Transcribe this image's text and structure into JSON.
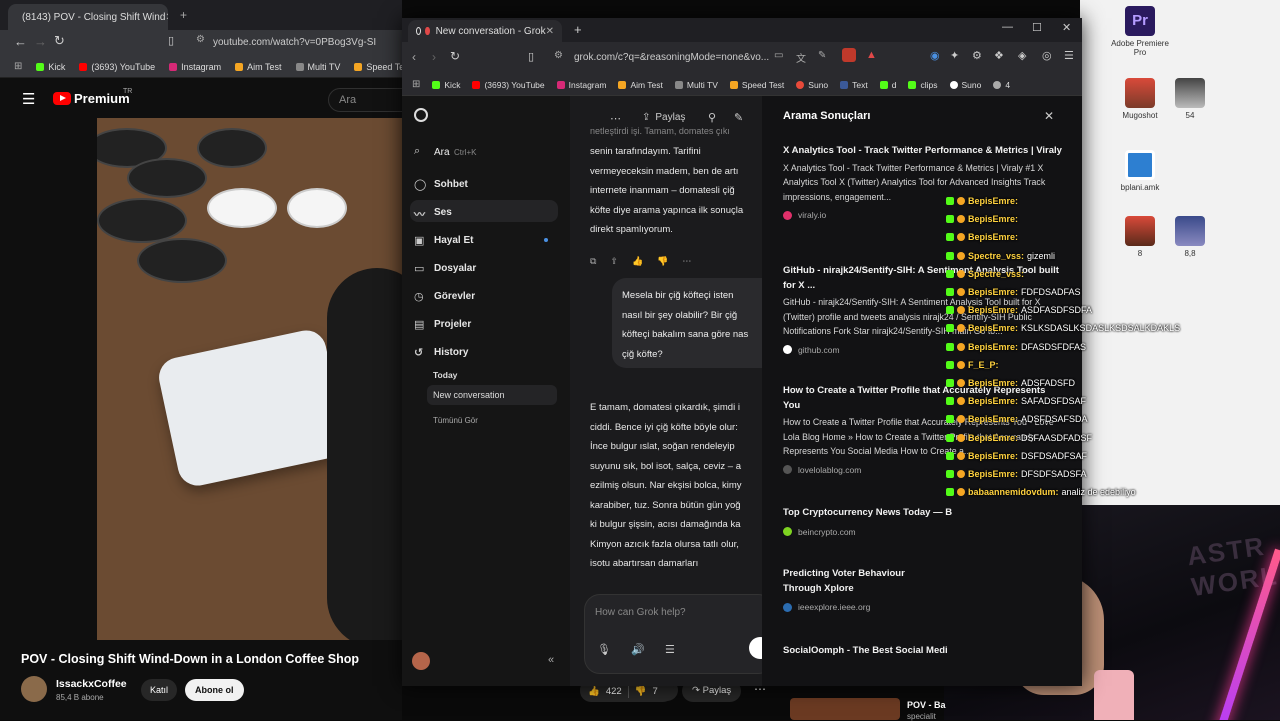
{
  "youtube_window": {
    "tab_title": "(8143) POV - Closing Shift Wind",
    "url": "youtube.com/watch?v=0PBog3Vg-SI",
    "bookmarks": [
      "Kick",
      "(3693) YouTube",
      "Instagram",
      "Aim Test",
      "Multi TV",
      "Speed Test"
    ],
    "logo_text": "Premium",
    "logo_sup": "TR",
    "search_placeholder": "Ara",
    "video_title": "POV - Closing Shift Wind-Down in a London Coffee Shop",
    "channel_name": "IssackxCoffee",
    "subscribers": "85,4 B abone",
    "join_label": "Katıl",
    "subscribe_label": "Abone ol",
    "likes": "422",
    "dislikes": "7",
    "share_label": "Paylaş",
    "next_video_title": "POV - Ba",
    "next_video_sub": "specialit"
  },
  "grok_window": {
    "tab_title": "New conversation - Grok",
    "url": "grok.com/c?q=&reasoningMode=none&vo...",
    "bookmarks": [
      "Kick",
      "(3693) YouTube",
      "Instagram",
      "Aim Test",
      "Multi TV",
      "Speed Test",
      "Suno",
      "Text",
      "d",
      "clips",
      "Suno",
      "4"
    ],
    "share_label": "Paylaş",
    "search_label": "Ara",
    "search_shortcut": "Ctrl+K",
    "sidebar": {
      "items": [
        {
          "label": "Sohbet",
          "icon": "chat-bubble-icon"
        },
        {
          "label": "Ses",
          "icon": "sound-wave-icon"
        },
        {
          "label": "Hayal Et",
          "icon": "image-icon"
        },
        {
          "label": "Dosyalar",
          "icon": "folder-icon"
        },
        {
          "label": "Görevler",
          "icon": "tasks-icon"
        },
        {
          "label": "Projeler",
          "icon": "projects-icon"
        },
        {
          "label": "History",
          "icon": "history-icon"
        }
      ],
      "history_today": "Today",
      "history_current": "New conversation",
      "history_all": "Tümünü Gör"
    },
    "chat": {
      "assistant_partial_top": "netleştirdi işi. Tamam, domates çıkı",
      "assistant_1": "senin tarafındayım. Tarifini\nvermeyeceksin madem, ben de artı\ninternete inanmam – domatesli çiğ\nköfte diye arama yapınca ilk sonuçla\ndirekt spamlıyorum.",
      "user_message": "Mesela bir çiğ köfteçi isten\nnasıl bir şey olabilir? Bir çiğ\nköfteçi bakalım sana göre nas\nçiğ köfte?",
      "assistant_2": "E tamam, domatesi çıkardık, şimdi i\nciddi. Bence iyi çiğ köfte böyle olur:\nİnce bulgur ıslat, soğan rendeleyip\nsuyunu sık, bol isot, salça, ceviz – a\nezilmiş olsun. Nar ekşisi bolca, kimy\nkarabiber, tuz. Sonra bütün gün yoğ\nki bulgur şişsin, acısı damağında ka\nKimyon azıcık fazla olursa tatlı olur,\nisotu abartırsan damarları",
      "input_placeholder": "How can Grok help?"
    },
    "search_panel": {
      "title": "Arama Sonuçları",
      "results": [
        {
          "title": "X Analytics Tool - Track Twitter Performance & Metrics | Viraly",
          "desc": "X Analytics Tool - Track Twitter Performance & Metrics | Viraly #1 X Analytics Tool X (Twitter) Analytics Tool for Advanced Insights Track impressions, engagement...",
          "source": "viraly.io",
          "color": "#e0306a"
        },
        {
          "title": "GitHub - nirajk24/Sentify-SIH: A Sentiment Analysis Tool built for X ...",
          "desc": "GitHub - nirajk24/Sentify-SIH: A Sentiment Analysis Tool built for X (Twitter) profile and tweets analysis nirajk24 / Sentify-SIH Public Notifications Fork Star nirajk24/Sentify-SIH main Go to...",
          "source": "github.com",
          "color": "#ffffff"
        },
        {
          "title": "How to Create a Twitter Profile that Accurately Represents You",
          "desc": "How to Create a Twitter Profile that Accurately Represents You - Love Lola Blog Home » How to Create a Twitter Profile that Accurately Represents You Social Media How to Create a...",
          "source": "lovelolablog.com",
          "color": "#555555"
        },
        {
          "title": "Top Cryptocurrency News Today — B",
          "desc": "",
          "source": "beincrypto.com",
          "color": "#7ed321"
        },
        {
          "title": "Predicting Voter Behaviour Through Xplore",
          "desc": "",
          "source": "ieeexplore.ieee.org",
          "color": "#2b6cb0"
        },
        {
          "title": "SocialOomph - The Best Social Medi",
          "desc": "",
          "source": "",
          "color": "#888888"
        }
      ]
    }
  },
  "stream_chat": [
    {
      "user": "BepisEmre:",
      "msg": "",
      "color": "#ffd23f"
    },
    {
      "user": "BepisEmre:",
      "msg": "",
      "color": "#ffd23f"
    },
    {
      "user": "BepisEmre:",
      "msg": "",
      "color": "#ffd23f"
    },
    {
      "user": "Spectre_vss:",
      "msg": "gizemli",
      "color": "#ffd23f"
    },
    {
      "user": "Spectre_vss:",
      "msg": "",
      "color": "#ffd23f"
    },
    {
      "user": "BepisEmre:",
      "msg": "FDFDSADFAS",
      "color": "#ffd23f"
    },
    {
      "user": "BepisEmre:",
      "msg": "ASDFASDFSDFA",
      "color": "#ffd23f"
    },
    {
      "user": "BepisEmre:",
      "msg": "KSLKSDASLKSDASLKSDSALKDAKLS",
      "color": "#ffd23f"
    },
    {
      "user": "BepisEmre:",
      "msg": "DFASDSFDFAS",
      "color": "#ffd23f"
    },
    {
      "user": "F_E_P:",
      "msg": "",
      "color": "#ffd23f"
    },
    {
      "user": "BepisEmre:",
      "msg": "ADSFADSFD",
      "color": "#ffd23f"
    },
    {
      "user": "BepisEmre:",
      "msg": "SAFADSFDSAF",
      "color": "#ffd23f"
    },
    {
      "user": "BepisEmre:",
      "msg": "ADSFDSAFSDA",
      "color": "#ffd23f"
    },
    {
      "user": "BepisEmre:",
      "msg": "DSFAASDFADSF",
      "color": "#ffd23f"
    },
    {
      "user": "BepisEmre:",
      "msg": "DSFDSADFSAF",
      "color": "#ffd23f"
    },
    {
      "user": "BepisEmre:",
      "msg": "DFSDFSADSFA",
      "color": "#ffd23f"
    },
    {
      "user": "babaannemidovdum:",
      "msg": "analiz de edebiliyo",
      "color": "#ffd23f"
    }
  ],
  "desktop_icons": [
    {
      "label": "Adobe Premiere Pro",
      "icon": "premiere-pro-icon",
      "text": "Pr"
    },
    {
      "label": "Mugoshot",
      "icon": "photo-icon"
    },
    {
      "label": "54",
      "icon": "photo-icon"
    },
    {
      "label": "bplani.amk",
      "icon": "document-icon"
    },
    {
      "label": "8",
      "icon": "photo-icon"
    },
    {
      "label": "8,8",
      "icon": "photo-icon"
    }
  ],
  "stream_overlay_text": "ASTR WORL"
}
